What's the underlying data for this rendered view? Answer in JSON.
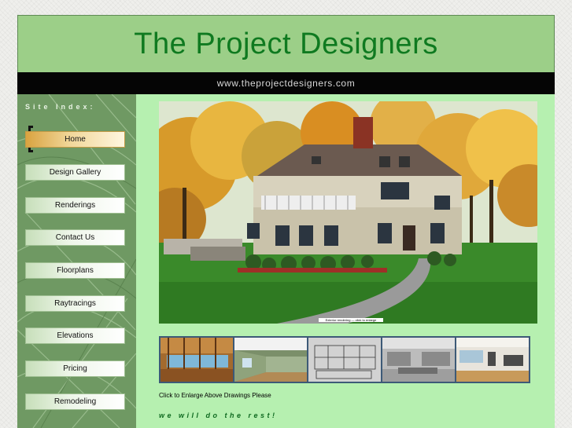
{
  "site": {
    "title": "The Project Designers",
    "url": "www.theprojectdesigners.com"
  },
  "sidebar": {
    "heading": "Site Index:",
    "items": [
      {
        "label": "Home",
        "active": true
      },
      {
        "label": "Design Gallery"
      },
      {
        "label": "Renderings"
      },
      {
        "label": "Contact Us"
      },
      {
        "label": "Floorplans"
      },
      {
        "label": "Raytracings"
      },
      {
        "label": "Elevations"
      },
      {
        "label": "Pricing"
      },
      {
        "label": "Remodeling"
      }
    ]
  },
  "main": {
    "hero_caption": "Exterior rendering — click to enlarge",
    "thumbnails": [
      "interior-framing",
      "interior-room",
      "kitchen-wireframe",
      "kitchen-render",
      "kitchen-finished"
    ],
    "enlarge_text": "Click to Enlarge Above Drawings Please",
    "tagline": "we will do the rest!"
  },
  "colors": {
    "header_bg": "#9ccf88",
    "title_color": "#0f7a20",
    "main_bg": "#b6f0b0",
    "sidebar_bg": "#6f9963",
    "active_button": "#d9a340"
  }
}
